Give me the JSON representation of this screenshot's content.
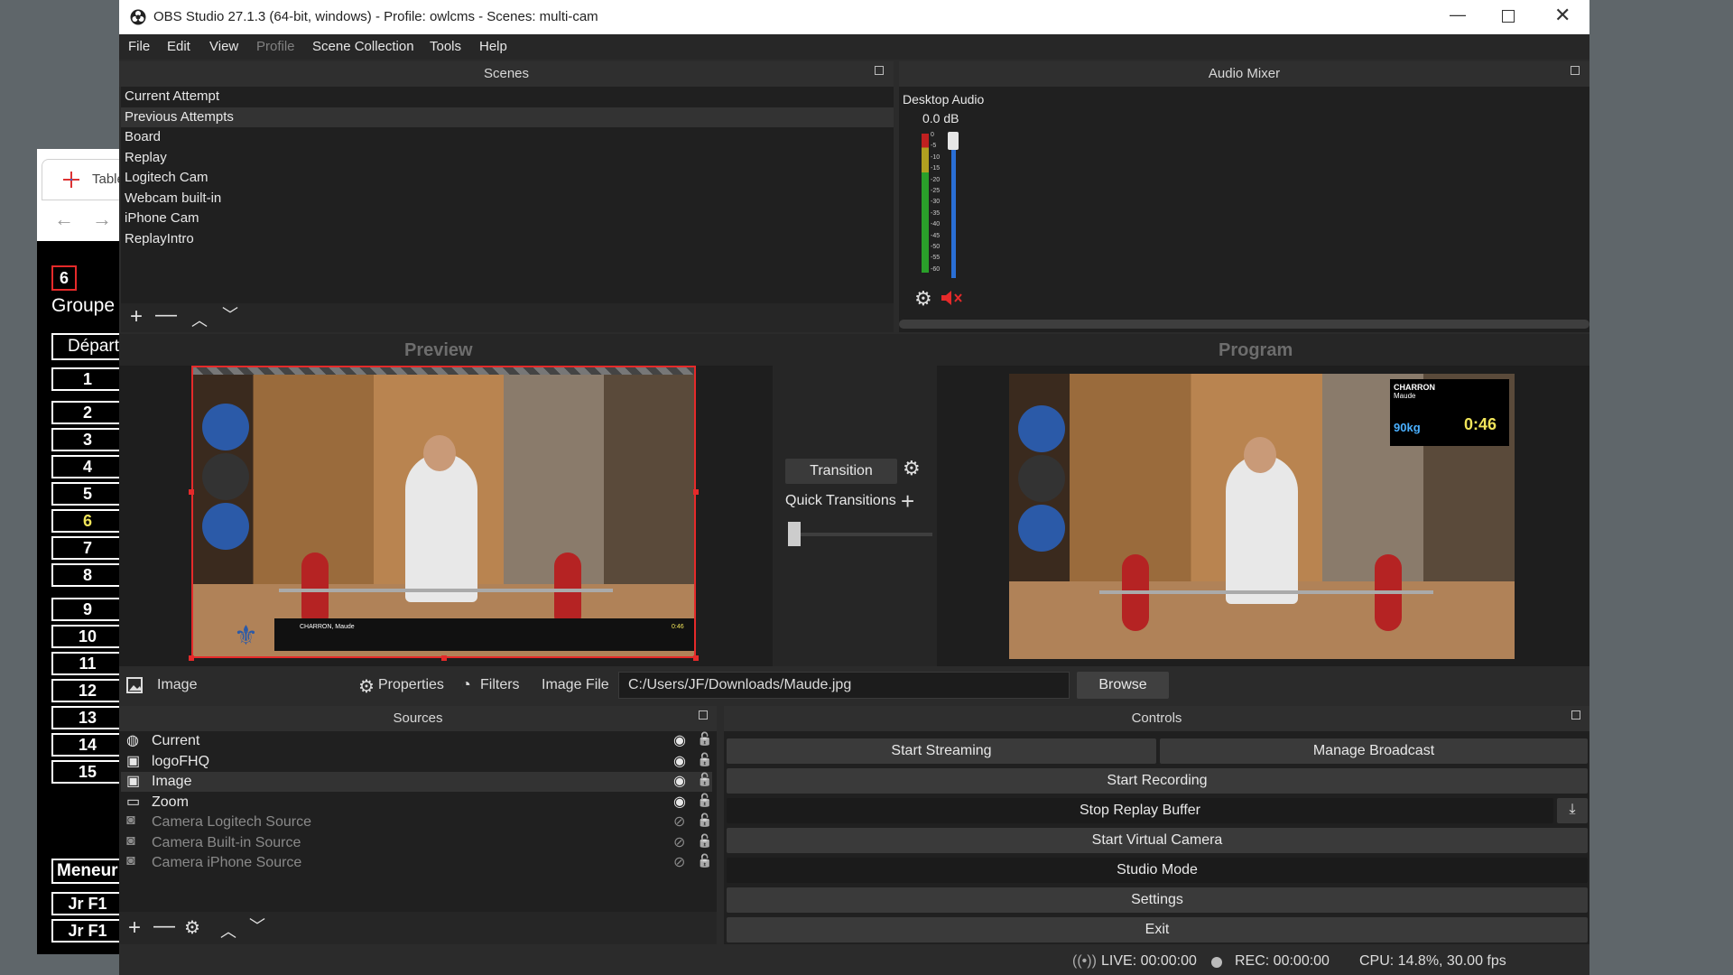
{
  "background_window": {
    "tab_title": "Table",
    "group_number": "6",
    "group_label": "Groupe",
    "depart_label": "Départ",
    "rows": [
      "1",
      "2",
      "3",
      "4",
      "5",
      "6",
      "7",
      "8",
      "9",
      "10",
      "11",
      "12",
      "13",
      "14",
      "15"
    ],
    "highlight_row": "6",
    "meneur_label": "Meneur",
    "jr_rows": [
      "Jr F1",
      "Jr F1"
    ]
  },
  "window": {
    "title": "OBS Studio 27.1.3 (64-bit, windows) - Profile: owlcms - Scenes: multi-cam"
  },
  "menu": [
    "File",
    "Edit",
    "View",
    "Profile",
    "Scene Collection",
    "Tools",
    "Help"
  ],
  "scenes": {
    "title": "Scenes",
    "items": [
      "Current Attempt",
      "Previous Attempts",
      "Board",
      "Replay",
      "Logitech Cam",
      "Webcam built-in",
      "iPhone Cam",
      "ReplayIntro"
    ],
    "selected": 1
  },
  "audio_mixer": {
    "title": "Audio Mixer",
    "channel": "Desktop Audio",
    "level": "0.0 dB",
    "scale": [
      "0",
      "-5",
      "-10",
      "-15",
      "-20",
      "-25",
      "-30",
      "-35",
      "-40",
      "-45",
      "-50",
      "-55",
      "-60"
    ]
  },
  "preview": {
    "label": "Preview"
  },
  "program": {
    "label": "Program"
  },
  "transition": {
    "button": "Transition",
    "quick": "Quick Transitions"
  },
  "overlay": {
    "name": "CHARRON",
    "first": "Maude",
    "weight": "90kg",
    "timer": "0:46"
  },
  "lower_third": {
    "name": "CHARRON, Maude",
    "timer": "0:46"
  },
  "source_bar": {
    "type": "Image",
    "properties": "Properties",
    "filters": "Filters",
    "file_label": "Image File",
    "file_path": "C:/Users/JF/Downloads/Maude.jpg",
    "browse": "Browse"
  },
  "sources": {
    "title": "Sources",
    "items": [
      {
        "name": "Current",
        "icon": "globe-icon",
        "visible": true
      },
      {
        "name": "logoFHQ",
        "icon": "image-icon",
        "visible": true
      },
      {
        "name": "Image",
        "icon": "image-icon",
        "visible": true
      },
      {
        "name": "Zoom",
        "icon": "monitor-icon",
        "visible": true
      },
      {
        "name": "Camera Logitech Source",
        "icon": "camera-icon",
        "visible": false
      },
      {
        "name": "Camera Built-in Source",
        "icon": "camera-icon",
        "visible": false
      },
      {
        "name": "Camera iPhone Source",
        "icon": "camera-icon",
        "visible": false
      }
    ]
  },
  "controls": {
    "title": "Controls",
    "start_streaming": "Start Streaming",
    "manage_broadcast": "Manage Broadcast",
    "start_recording": "Start Recording",
    "stop_replay": "Stop Replay Buffer",
    "virtual_camera": "Start Virtual Camera",
    "studio_mode": "Studio Mode",
    "settings": "Settings",
    "exit": "Exit"
  },
  "status": {
    "live": "LIVE: 00:00:00",
    "rec": "REC: 00:00:00",
    "cpu": "CPU: 14.8%, 30.00 fps"
  },
  "colors": {
    "accent_red": "#e52a2a",
    "meter_blue": "#2a6fd6",
    "timer_yellow": "#f0e45a"
  }
}
